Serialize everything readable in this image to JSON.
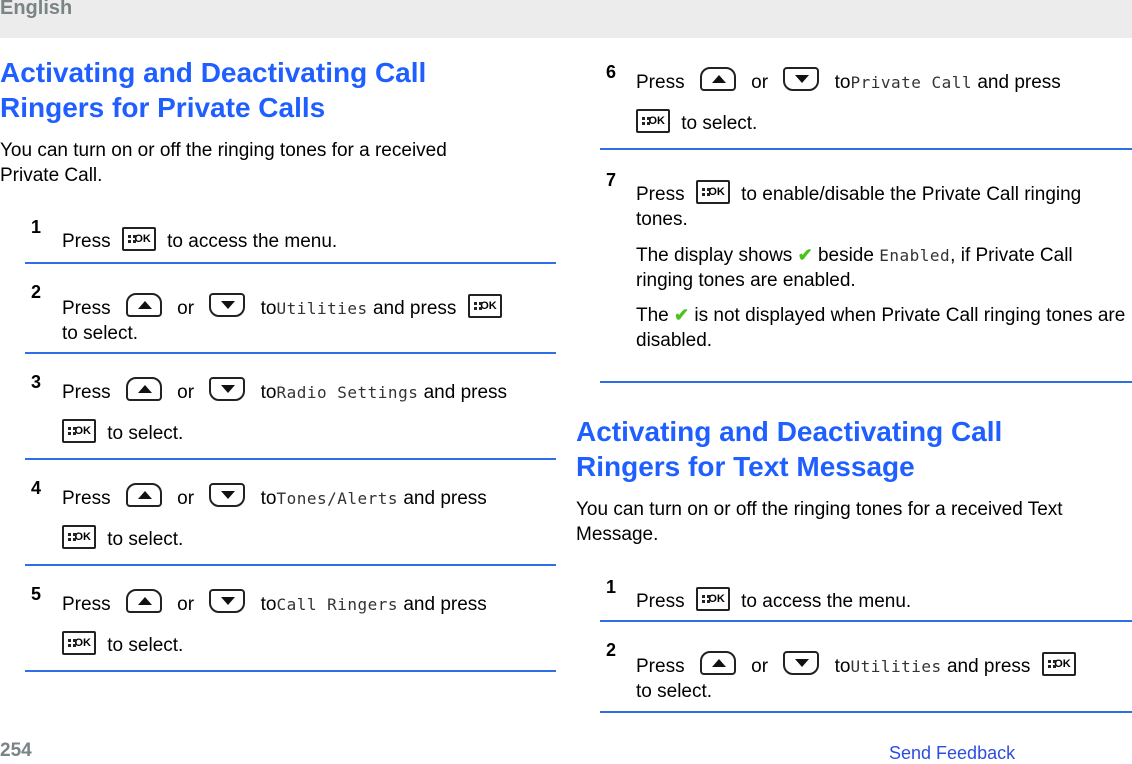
{
  "header": {
    "language": "English"
  },
  "left": {
    "title_line1": "Activating and Deactivating Call",
    "title_line2": "Ringers for Private Calls",
    "intro_line1": "You can turn on or off the ringing tones for a received",
    "intro_line2": "Private Call.",
    "steps": [
      {
        "num": "1",
        "press": "Press",
        "after_ok": "to access the menu."
      },
      {
        "num": "2",
        "press": "Press",
        "or": "or",
        "to": "to",
        "item": "Utilities",
        "and_press": "and press",
        "select": "to select."
      },
      {
        "num": "3",
        "press": "Press",
        "or": "or",
        "to": "to",
        "item": "Radio Settings",
        "and_press": "and press",
        "select": "to select."
      },
      {
        "num": "4",
        "press": "Press",
        "or": "or",
        "to": "to",
        "item": "Tones/Alerts",
        "and_press": "and press",
        "select": "to select."
      },
      {
        "num": "5",
        "press": "Press",
        "or": "or",
        "to": "to",
        "item": "Call Ringers",
        "and_press": "and press",
        "select": "to select."
      }
    ]
  },
  "right": {
    "step6": {
      "num": "6",
      "press": "Press",
      "or": "or",
      "to": "to",
      "item": "Private Call",
      "and_press": "and press",
      "select": "to select."
    },
    "step7": {
      "num": "7",
      "press": "Press",
      "text": "to enable/disable the Private Call ringing tones.",
      "para1_a": "The display shows",
      "para1_b": "beside",
      "para1_item": "Enabled",
      "para1_c": ", if Private Call ringing tones are enabled.",
      "para2_a": "The",
      "para2_b": "is not displayed when Private Call ringing tones are disabled."
    },
    "title_line1": "Activating and Deactivating Call",
    "title_line2": "Ringers for Text Message",
    "intro": "You can turn on or off the ringing tones for a received Text Message.",
    "steps": [
      {
        "num": "1",
        "press": "Press",
        "after_ok": "to access the menu."
      },
      {
        "num": "2",
        "press": "Press",
        "or": "or",
        "to": "to",
        "item": "Utilities",
        "and_press": "and press",
        "select": "to select."
      }
    ]
  },
  "icons": {
    "ok_key": "menu-ok-key-icon",
    "up_key": "up-arrow-key-icon",
    "down_key": "down-arrow-key-icon",
    "check": "checkmark-icon",
    "check_glyph": "✔",
    "ok_label": "OK"
  },
  "footer": {
    "page_number": "254",
    "feedback_link": "Send Feedback"
  },
  "colors": {
    "heading": "#1f5fff",
    "rule": "#2f6ee5",
    "header_bg": "#ececec",
    "check": "#4cc21c",
    "link": "#2d4de0"
  }
}
